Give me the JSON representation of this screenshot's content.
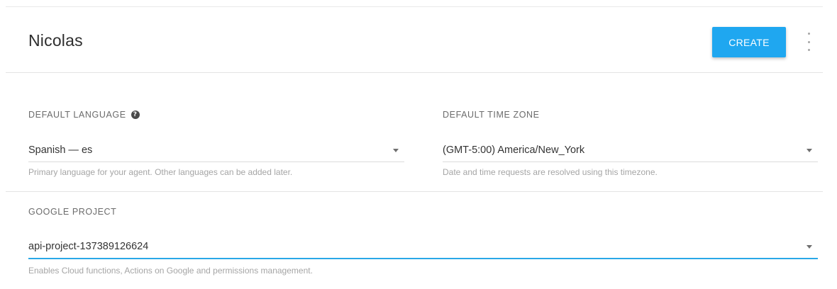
{
  "header": {
    "agent_name": "Nicolas",
    "create_label": "CREATE",
    "more_icon": "more-vert-icon"
  },
  "language": {
    "label": "DEFAULT LANGUAGE",
    "help_icon": "help-circle-icon",
    "value": "Spanish — es",
    "helper": "Primary language for your agent. Other languages can be added later."
  },
  "timezone": {
    "label": "DEFAULT TIME ZONE",
    "value": "(GMT-5:00) America/New_York",
    "helper": "Date and time requests are resolved using this timezone."
  },
  "project": {
    "label": "GOOGLE PROJECT",
    "value": "api-project-137389126624",
    "helper": "Enables Cloud functions, Actions on Google and permissions management."
  },
  "colors": {
    "accent": "#1fa7f0",
    "active_underline": "#29a8e8"
  }
}
